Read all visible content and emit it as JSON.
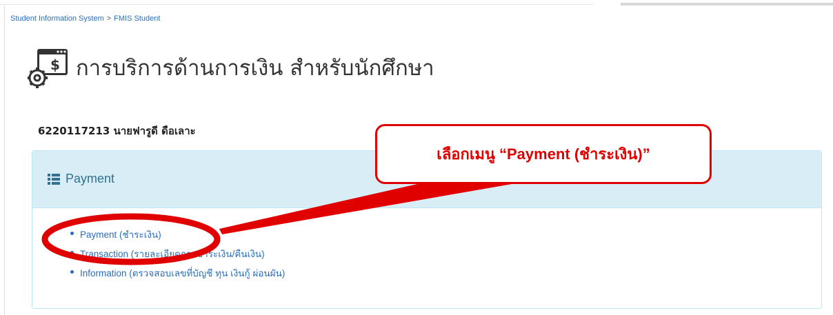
{
  "breadcrumb": {
    "root": "Student Information System",
    "separator": ">",
    "current": "FMIS Student"
  },
  "page_title": "การบริการด้านการเงิน สำหรับนักศึกษา",
  "student": {
    "id": "6220117213",
    "name": "นายฟารูดี ดือเลาะ"
  },
  "panel": {
    "title": "Payment",
    "items": [
      {
        "label": "Payment (ชำระเงิน)"
      },
      {
        "label": "Transaction (รายละเอียดการชำระเงิน/คืนเงิน)"
      },
      {
        "label": "Information (ตรวจสอบเลขที่บัญชี ทุน เงินกู้ ผ่อนผัน)"
      }
    ]
  },
  "annotation": {
    "callout": "เลือกเมนู “Payment (ชำระเงิน)”",
    "color": "#e00000"
  },
  "colors": {
    "link": "#2a6ebb",
    "panel_head": "#d9edf7",
    "panel_border": "#bce8f1",
    "panel_title": "#31708f"
  }
}
